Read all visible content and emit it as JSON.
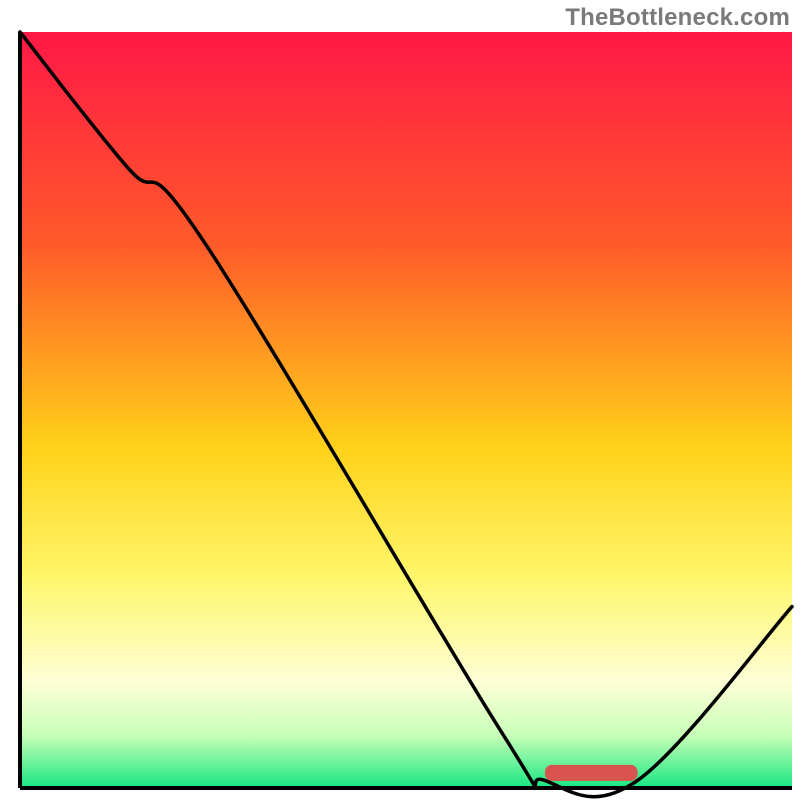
{
  "watermark": "TheBottleneck.com",
  "chart_data": {
    "type": "line",
    "title": "",
    "xlabel": "",
    "ylabel": "",
    "xlim": [
      0,
      100
    ],
    "ylim": [
      0,
      100
    ],
    "gradient_stops": [
      {
        "offset": 0,
        "color": "#ff1846"
      },
      {
        "offset": 28,
        "color": "#ff5a2a"
      },
      {
        "offset": 55,
        "color": "#ffd21a"
      },
      {
        "offset": 72,
        "color": "#fff66a"
      },
      {
        "offset": 86,
        "color": "#fdffd6"
      },
      {
        "offset": 93,
        "color": "#c8ffb8"
      },
      {
        "offset": 100,
        "color": "#17e783"
      }
    ],
    "curve": {
      "comment": "x,y in percent of plot area; y=0 at bottom, 100 at top",
      "points": [
        {
          "x": 0.0,
          "y": 100.0
        },
        {
          "x": 14.0,
          "y": 82.0
        },
        {
          "x": 24.0,
          "y": 72.0
        },
        {
          "x": 62.0,
          "y": 8.0
        },
        {
          "x": 68.0,
          "y": 1.0
        },
        {
          "x": 80.0,
          "y": 1.0
        },
        {
          "x": 100.0,
          "y": 24.0
        }
      ]
    },
    "marker": {
      "comment": "rounded red bar near the valley floor",
      "x_start": 68.0,
      "x_end": 80.0,
      "y": 2.0,
      "color": "#d9534f"
    },
    "frame": {
      "left_pct": 2.5,
      "right_pct": 99.0,
      "top_pct": 4.0,
      "bottom_pct": 98.5
    }
  }
}
